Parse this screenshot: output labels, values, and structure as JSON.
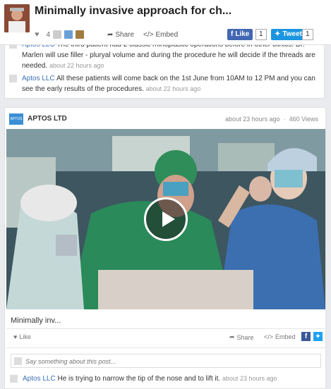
{
  "header": {
    "title": "Minimally invasive approach for ch...",
    "like_count": "4",
    "share_label": "Share",
    "embed_label": "Embed",
    "fb_like_label": "Like",
    "fb_like_count": "1",
    "tweet_label": "Tweet",
    "tweet_count": "1"
  },
  "comments": [
    {
      "author": "Aptos LLC",
      "text": "The third patient had 2 classic rhinoplastic operations before in other clinics. Dr. Marlen will use filler - pluryal volume and during the procedure he will decide if the threads are needed.",
      "time": "about 22 hours ago"
    },
    {
      "author": "Aptos LLC",
      "text": "All these patients will come back on the 1st June from 10AM to 12 PM and you can see the early results of the procedures.",
      "time": "about 22 hours ago"
    }
  ],
  "post": {
    "author": "APTOS LTD",
    "logo_text": "APTOS",
    "time": "about 23 hours ago",
    "views": "460 Views",
    "video_title": "Minimally inv...",
    "like_label": "Like",
    "share_label": "Share",
    "embed_label": "Embed",
    "comment_placeholder": "Say something about this post...",
    "comment": {
      "author": "Aptos LLC",
      "text": "He is trying to narrow the tip of the nose and to lift it.",
      "time": "about 23 hours ago"
    }
  },
  "colors": {
    "facebook": "#4267b2",
    "twitter": "#1b95e0",
    "link": "#3a6fb5"
  }
}
